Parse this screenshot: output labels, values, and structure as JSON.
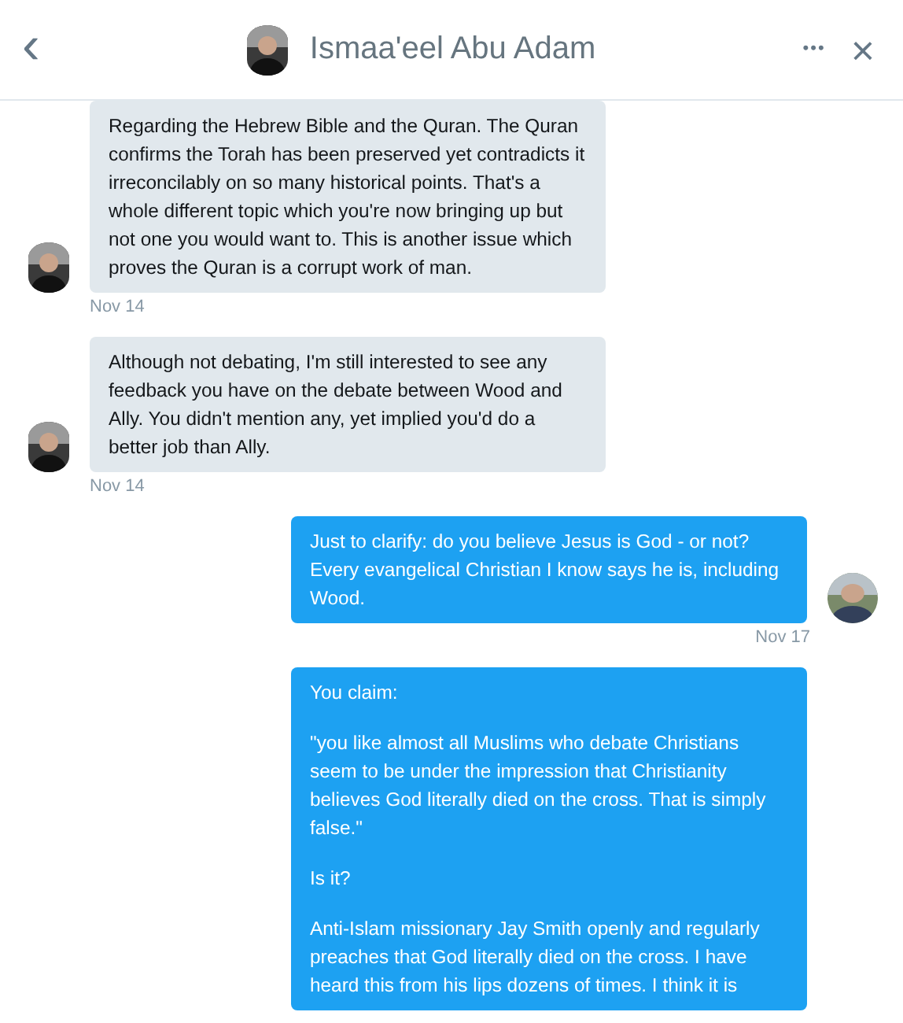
{
  "header": {
    "back": "‹",
    "title": "Ismaa'eel Abu Adam",
    "more": "•••",
    "close": "×"
  },
  "messages": [
    {
      "kind": "received",
      "show_avatar": true,
      "paragraphs": [
        "Regarding the Hebrew Bible and the Quran. The Quran confirms the Torah has been preserved yet contradicts it irreconcilably on so many historical points. That's a whole different topic which you're now bringing up but not one you would want to. This is another issue which proves the Quran is a corrupt work of man."
      ],
      "time": "Nov 14"
    },
    {
      "kind": "received",
      "show_avatar": true,
      "paragraphs": [
        "Although not debating, I'm still interested to see any feedback you have on the debate between Wood and Ally. You didn't mention any, yet implied you'd do a better job than Ally."
      ],
      "time": "Nov 14"
    },
    {
      "kind": "sent",
      "show_avatar": true,
      "paragraphs": [
        "Just to clarify: do you believe Jesus is God - or not? Every evangelical Christian I know says he is, including Wood."
      ],
      "time": "Nov 17"
    },
    {
      "kind": "sent",
      "show_avatar": false,
      "paragraphs": [
        "You claim:",
        "\"you like almost all Muslims who debate Christians seem to be under the impression that Christianity believes God literally died on the cross. That is simply false.\"",
        "Is it?",
        "Anti-Islam missionary Jay Smith openly and regularly preaches that God literally died on the cross. I have heard this from his lips dozens of times. I think it is"
      ]
    }
  ]
}
